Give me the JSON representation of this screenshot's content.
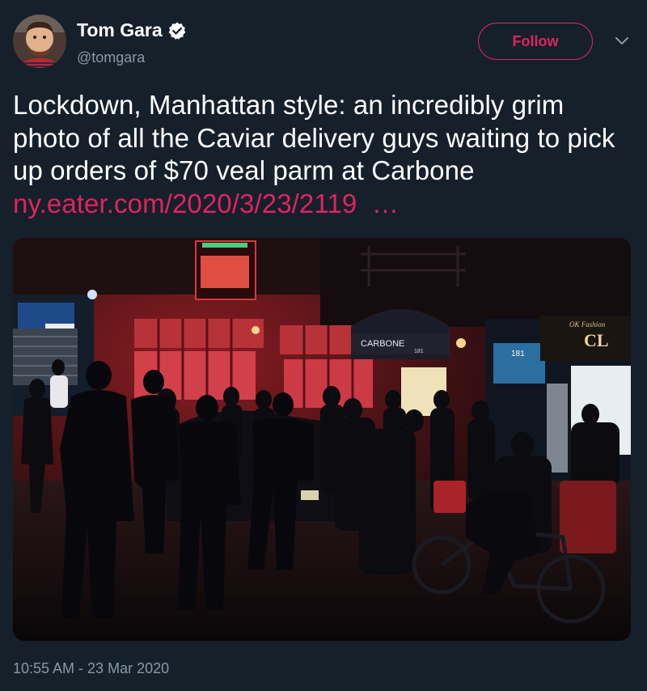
{
  "author": {
    "display_name": "Tom Gara",
    "handle": "@tomgara",
    "verified": true,
    "avatar_icon": "profile-photo"
  },
  "follow_button": {
    "label": "Follow"
  },
  "menu": {
    "icon": "chevron-down-icon"
  },
  "tweet": {
    "text": "Lockdown, Manhattan style: an incredibly grim photo of all the Caviar delivery guys waiting to pick up orders of $70 veal parm at Carbone ",
    "link_text": "ny.eater.com/2020/3/23/2119  …",
    "timestamp": "10:55 AM - 23 Mar 2020"
  },
  "media": {
    "awning_text": "CARBONE",
    "awning_sub": "181",
    "shop_sign": "OK Fashion",
    "shop_sign_big": "CL",
    "door_number": "181"
  },
  "colors": {
    "background": "#15202b",
    "accent": "#e0245e",
    "secondary_text": "#8899a6",
    "verified_badge": "#ffffff"
  }
}
